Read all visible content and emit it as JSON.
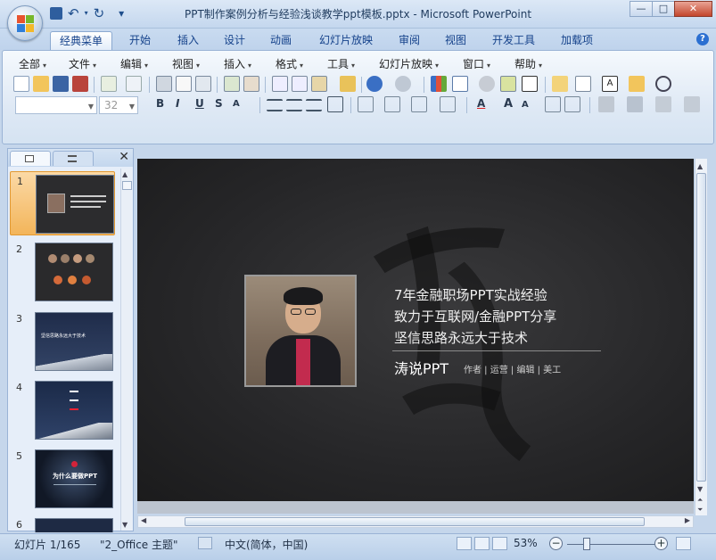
{
  "window": {
    "title": "PPT制作案例分析与经验浅谈教学ppt模板.pptx - Microsoft PowerPoint",
    "controls": [
      "—",
      "□",
      "✕"
    ]
  },
  "quick_access": {
    "save": "save-icon",
    "undo": "↶",
    "redo": "↻",
    "customize": "▾"
  },
  "ribbon_tabs": [
    "经典菜单",
    "开始",
    "插入",
    "设计",
    "动画",
    "幻灯片放映",
    "审阅",
    "视图",
    "开发工具",
    "加载项"
  ],
  "help_label": "?",
  "classic_menu": [
    "全部",
    "文件",
    "编辑",
    "视图",
    "插入",
    "格式",
    "工具",
    "幻灯片放映",
    "窗口",
    "帮助"
  ],
  "font": {
    "name_value": "",
    "size_value": "32"
  },
  "format_buttons": [
    "B",
    "I",
    "U",
    "S",
    "A"
  ],
  "text_color_letters": [
    "A",
    "A",
    "A"
  ],
  "slides_pane": {
    "tabs": [
      "slides-tab",
      "outline-tab"
    ],
    "close": "✕",
    "slides": [
      {
        "num": "1",
        "kind": "title"
      },
      {
        "num": "2",
        "kind": "people"
      },
      {
        "num": "3",
        "kind": "mountain",
        "text": "坚信思路永远大于技术"
      },
      {
        "num": "4",
        "kind": "mountain-list"
      },
      {
        "num": "5",
        "kind": "burst",
        "text": "为什么要做PPT"
      },
      {
        "num": "6",
        "kind": "partial"
      }
    ]
  },
  "slide": {
    "lines": [
      "7年金融职场PPT实战经验",
      "致力于互联网/金融PPT分享",
      "坚信思路永远大于技术"
    ],
    "author": "涛说PPT",
    "roles": "作者 | 运营 | 编辑 | 美工"
  },
  "status_bar": {
    "slide_counter": "幻灯片 1/165",
    "theme": "\"2_Office 主题\"",
    "language": "中文(简体，中国)",
    "zoom": "53%",
    "zoom_out": "−",
    "zoom_in": "+"
  },
  "colors": {
    "accent": "#15428b",
    "selection": "#f3b55a",
    "slide_bg": "#262628"
  }
}
